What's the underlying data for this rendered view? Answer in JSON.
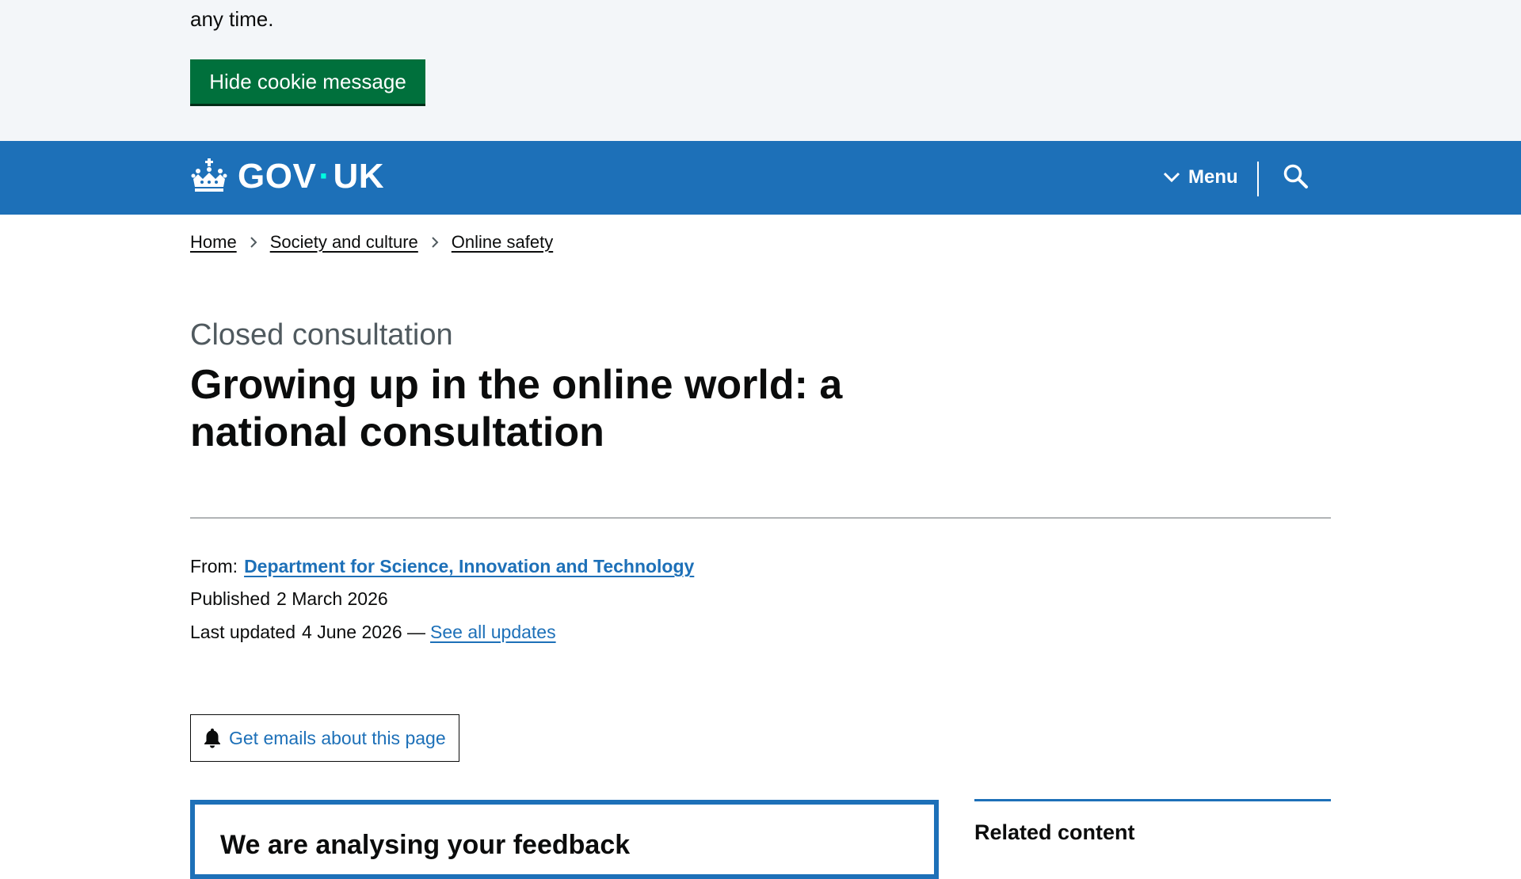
{
  "cookie_banner": {
    "visible_text": "any time.",
    "hide_button": "Hide cookie message"
  },
  "header": {
    "logo_left": "GOV",
    "logo_dot": "·",
    "logo_right": "UK",
    "menu_label": "Menu",
    "colors": {
      "background": "#1d70b8",
      "dot": "#00ffe0"
    }
  },
  "breadcrumbs": [
    {
      "label": "Home"
    },
    {
      "label": "Society and culture"
    },
    {
      "label": "Online safety"
    }
  ],
  "page": {
    "caption": "Closed consultation",
    "title": "Growing up in the online world: a national consultation"
  },
  "metadata": {
    "from_label": "From:",
    "organisation": "Department for Science, Innovation and Technology",
    "published_label": "Published",
    "published_date": "2 March 2026",
    "updated_label": "Last updated",
    "updated_date": "4 June 2026 —",
    "updates_link": "See all updates"
  },
  "email_signup": {
    "label": "Get emails about this page"
  },
  "notice": {
    "heading": "We are analysing your feedback"
  },
  "related": {
    "heading": "Related content"
  }
}
